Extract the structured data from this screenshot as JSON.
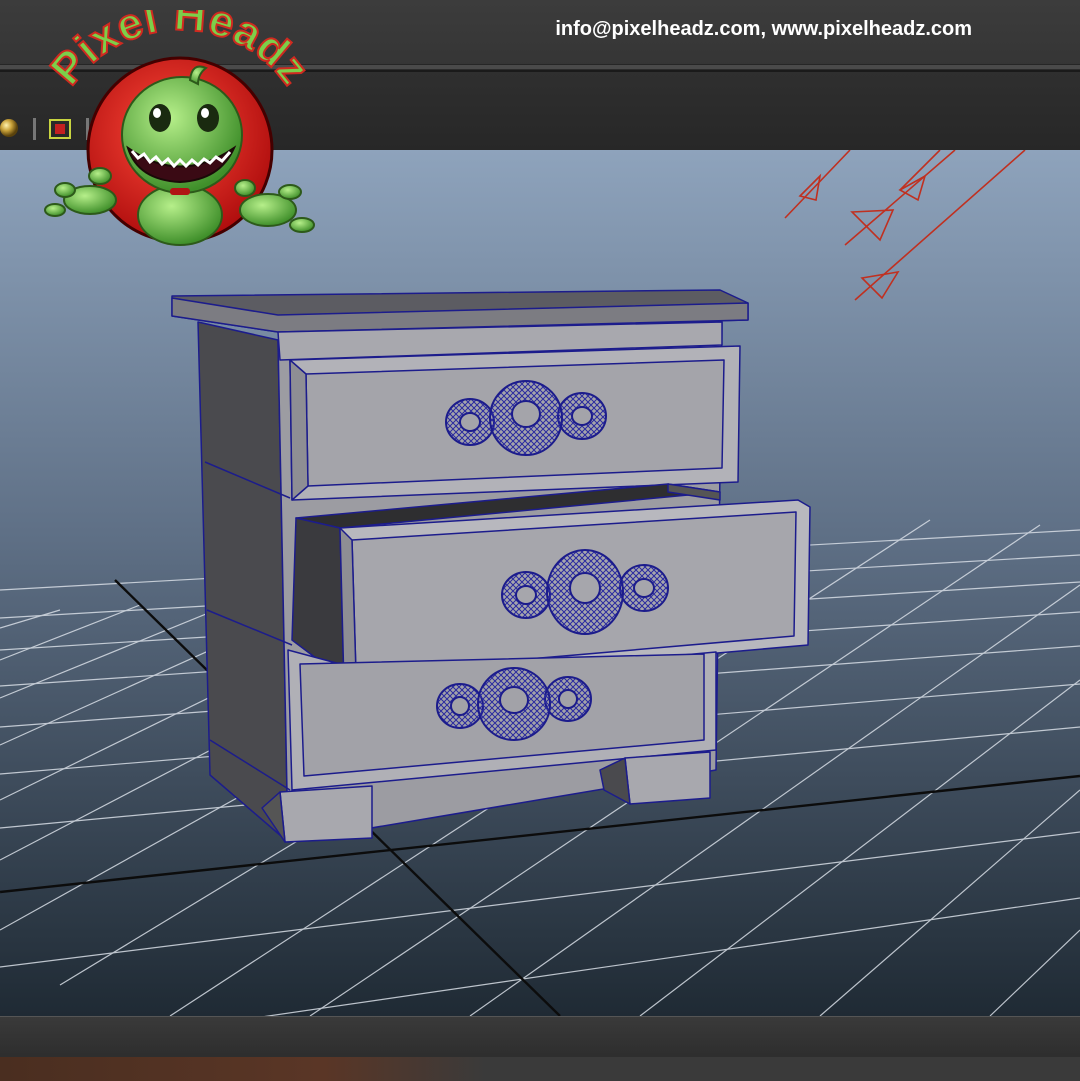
{
  "header": {
    "contact": "info@pixelheadz.com, www.pixelheadz.com"
  },
  "logo": {
    "text": "Pixel Headz",
    "colors": {
      "ring": "#e02020",
      "letters": "#7ccf4a",
      "character": "#6fbf4a"
    }
  },
  "toolbar": {
    "tools": [
      {
        "name": "sphere-light-icon"
      },
      {
        "name": "separator-icon"
      },
      {
        "name": "snapshot-icon"
      },
      {
        "name": "separator-icon"
      },
      {
        "name": "cube-icon"
      },
      {
        "name": "layers-icon"
      },
      {
        "name": "share-icon"
      }
    ]
  },
  "viewport": {
    "colors": {
      "sky_top": "#8ea3bc",
      "sky_bottom": "#1f2a34",
      "grid": "#d8dee6",
      "wire": "#1c1c8c",
      "mesh": "#a9a9ad"
    },
    "object": "nightstand-with-drawers"
  }
}
